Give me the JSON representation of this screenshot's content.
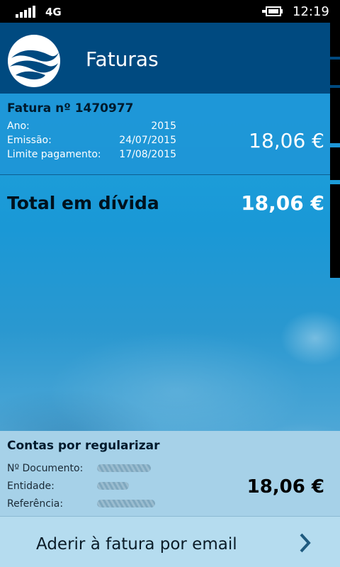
{
  "status_bar": {
    "network": "4G",
    "time": "12:19"
  },
  "header": {
    "title": "Faturas",
    "logo_icon": "water-logo-icon"
  },
  "invoice": {
    "title": "Fatura nº 1470977",
    "fields": [
      {
        "label": "Ano:",
        "value": "2015"
      },
      {
        "label": "Emissão:",
        "value": "24/07/2015"
      },
      {
        "label": "Limite pagamento:",
        "value": "17/08/2015"
      }
    ],
    "amount": "18,06 €"
  },
  "total": {
    "label": "Total em dívida",
    "value": "18,06 €"
  },
  "accounts": {
    "title": "Contas por regularizar",
    "fields": [
      {
        "label": "Nº Documento:"
      },
      {
        "label": "Entidade:"
      },
      {
        "label": "Referência:"
      }
    ],
    "amount": "18,06 €"
  },
  "email_button": {
    "label": "Aderir à fatura por email",
    "icon": "chevron-right-icon"
  },
  "colors": {
    "header_bg": "#004a80",
    "accent_blue": "#1e9ad8",
    "panel_light": "#a6d1e8"
  }
}
